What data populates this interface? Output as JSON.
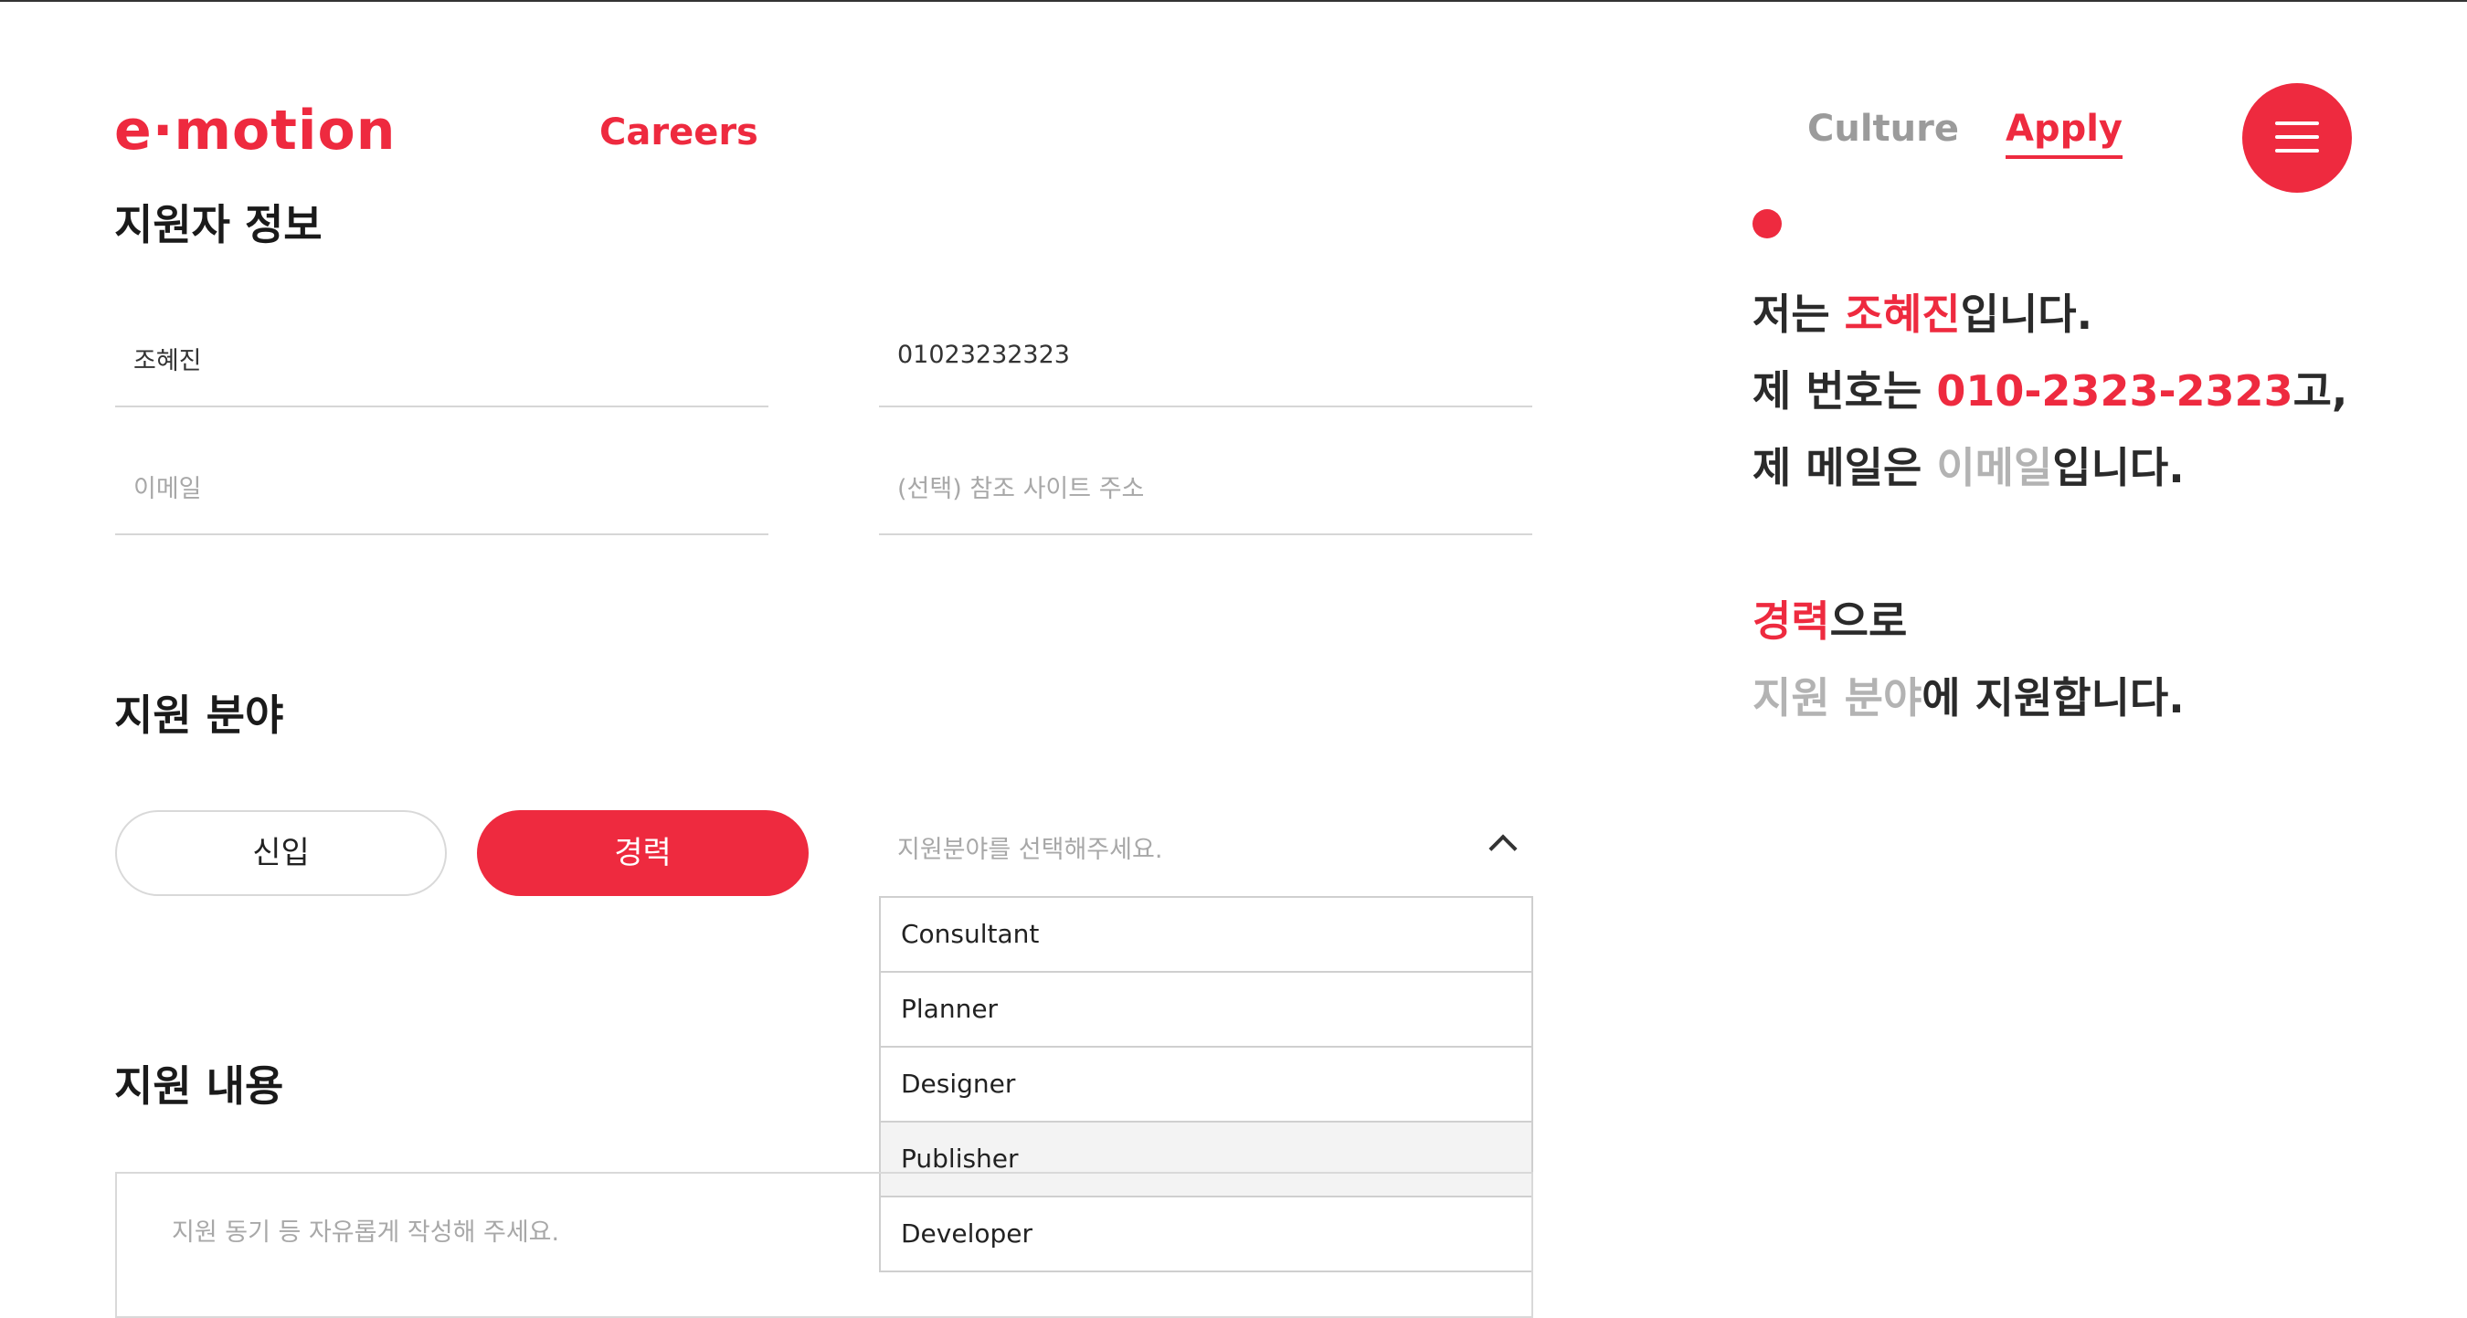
{
  "header": {
    "logo": "e·motion",
    "nav_careers": "Careers",
    "nav_culture": "Culture",
    "nav_apply": "Apply"
  },
  "applicant": {
    "title": "지원자 정보",
    "name_value": "조혜진",
    "phone_value": "01023232323",
    "email_placeholder": "이메일",
    "site_placeholder": "(선택) 참조 사이트 주소"
  },
  "field_section": {
    "title": "지원 분야",
    "option_new": "신입",
    "option_experienced": "경력",
    "select_placeholder": "지원분야를 선택해주세요.",
    "options": [
      "Consultant",
      "Planner",
      "Designer",
      "Publisher",
      "Developer"
    ],
    "hovered_option": "Publisher"
  },
  "content_section": {
    "title": "지원 내용",
    "textarea_placeholder": "지원 동기 등 자유롭게 작성해 주세요."
  },
  "summary": {
    "l1_pre": "저는 ",
    "l1_name": "조혜진",
    "l1_post": "입니다.",
    "l2_pre": "제 번호는 ",
    "l2_phone": "010-2323-2323",
    "l2_post": "고,",
    "l3_pre": "제 메일은 ",
    "l3_email": "이메일",
    "l3_post": "입니다.",
    "l4_type": "경력",
    "l4_post": "으로",
    "l5_field": "지원 분야",
    "l5_post": "에 지원합니다."
  },
  "colors": {
    "accent": "#ee2a3f",
    "placeholder": "#a8a8a8",
    "text": "#222222"
  }
}
